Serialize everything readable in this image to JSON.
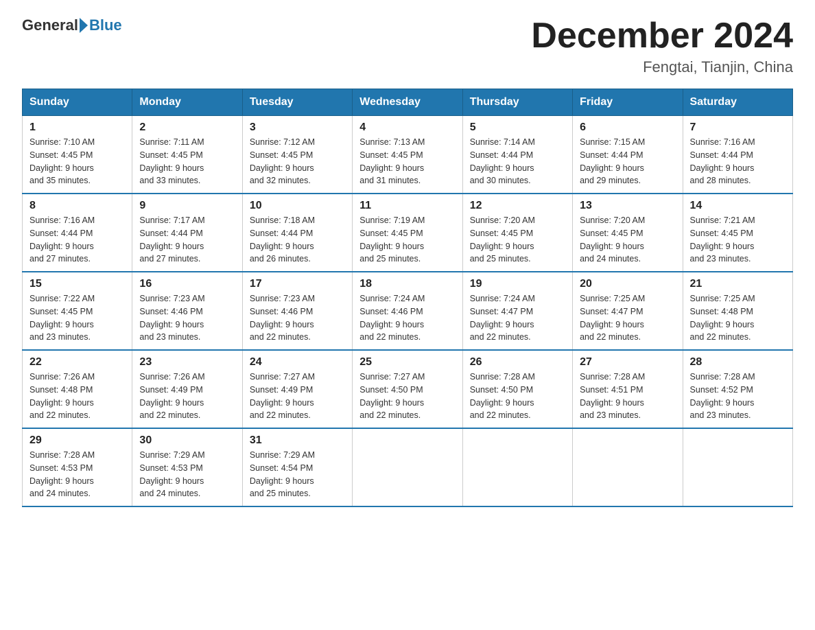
{
  "logo": {
    "general": "General",
    "blue": "Blue"
  },
  "title": {
    "month_year": "December 2024",
    "location": "Fengtai, Tianjin, China"
  },
  "headers": [
    "Sunday",
    "Monday",
    "Tuesday",
    "Wednesday",
    "Thursday",
    "Friday",
    "Saturday"
  ],
  "weeks": [
    [
      {
        "day": "1",
        "sunrise": "7:10 AM",
        "sunset": "4:45 PM",
        "daylight": "9 hours and 35 minutes."
      },
      {
        "day": "2",
        "sunrise": "7:11 AM",
        "sunset": "4:45 PM",
        "daylight": "9 hours and 33 minutes."
      },
      {
        "day": "3",
        "sunrise": "7:12 AM",
        "sunset": "4:45 PM",
        "daylight": "9 hours and 32 minutes."
      },
      {
        "day": "4",
        "sunrise": "7:13 AM",
        "sunset": "4:45 PM",
        "daylight": "9 hours and 31 minutes."
      },
      {
        "day": "5",
        "sunrise": "7:14 AM",
        "sunset": "4:44 PM",
        "daylight": "9 hours and 30 minutes."
      },
      {
        "day": "6",
        "sunrise": "7:15 AM",
        "sunset": "4:44 PM",
        "daylight": "9 hours and 29 minutes."
      },
      {
        "day": "7",
        "sunrise": "7:16 AM",
        "sunset": "4:44 PM",
        "daylight": "9 hours and 28 minutes."
      }
    ],
    [
      {
        "day": "8",
        "sunrise": "7:16 AM",
        "sunset": "4:44 PM",
        "daylight": "9 hours and 27 minutes."
      },
      {
        "day": "9",
        "sunrise": "7:17 AM",
        "sunset": "4:44 PM",
        "daylight": "9 hours and 27 minutes."
      },
      {
        "day": "10",
        "sunrise": "7:18 AM",
        "sunset": "4:44 PM",
        "daylight": "9 hours and 26 minutes."
      },
      {
        "day": "11",
        "sunrise": "7:19 AM",
        "sunset": "4:45 PM",
        "daylight": "9 hours and 25 minutes."
      },
      {
        "day": "12",
        "sunrise": "7:20 AM",
        "sunset": "4:45 PM",
        "daylight": "9 hours and 25 minutes."
      },
      {
        "day": "13",
        "sunrise": "7:20 AM",
        "sunset": "4:45 PM",
        "daylight": "9 hours and 24 minutes."
      },
      {
        "day": "14",
        "sunrise": "7:21 AM",
        "sunset": "4:45 PM",
        "daylight": "9 hours and 23 minutes."
      }
    ],
    [
      {
        "day": "15",
        "sunrise": "7:22 AM",
        "sunset": "4:45 PM",
        "daylight": "9 hours and 23 minutes."
      },
      {
        "day": "16",
        "sunrise": "7:23 AM",
        "sunset": "4:46 PM",
        "daylight": "9 hours and 23 minutes."
      },
      {
        "day": "17",
        "sunrise": "7:23 AM",
        "sunset": "4:46 PM",
        "daylight": "9 hours and 22 minutes."
      },
      {
        "day": "18",
        "sunrise": "7:24 AM",
        "sunset": "4:46 PM",
        "daylight": "9 hours and 22 minutes."
      },
      {
        "day": "19",
        "sunrise": "7:24 AM",
        "sunset": "4:47 PM",
        "daylight": "9 hours and 22 minutes."
      },
      {
        "day": "20",
        "sunrise": "7:25 AM",
        "sunset": "4:47 PM",
        "daylight": "9 hours and 22 minutes."
      },
      {
        "day": "21",
        "sunrise": "7:25 AM",
        "sunset": "4:48 PM",
        "daylight": "9 hours and 22 minutes."
      }
    ],
    [
      {
        "day": "22",
        "sunrise": "7:26 AM",
        "sunset": "4:48 PM",
        "daylight": "9 hours and 22 minutes."
      },
      {
        "day": "23",
        "sunrise": "7:26 AM",
        "sunset": "4:49 PM",
        "daylight": "9 hours and 22 minutes."
      },
      {
        "day": "24",
        "sunrise": "7:27 AM",
        "sunset": "4:49 PM",
        "daylight": "9 hours and 22 minutes."
      },
      {
        "day": "25",
        "sunrise": "7:27 AM",
        "sunset": "4:50 PM",
        "daylight": "9 hours and 22 minutes."
      },
      {
        "day": "26",
        "sunrise": "7:28 AM",
        "sunset": "4:50 PM",
        "daylight": "9 hours and 22 minutes."
      },
      {
        "day": "27",
        "sunrise": "7:28 AM",
        "sunset": "4:51 PM",
        "daylight": "9 hours and 23 minutes."
      },
      {
        "day": "28",
        "sunrise": "7:28 AM",
        "sunset": "4:52 PM",
        "daylight": "9 hours and 23 minutes."
      }
    ],
    [
      {
        "day": "29",
        "sunrise": "7:28 AM",
        "sunset": "4:53 PM",
        "daylight": "9 hours and 24 minutes."
      },
      {
        "day": "30",
        "sunrise": "7:29 AM",
        "sunset": "4:53 PM",
        "daylight": "9 hours and 24 minutes."
      },
      {
        "day": "31",
        "sunrise": "7:29 AM",
        "sunset": "4:54 PM",
        "daylight": "9 hours and 25 minutes."
      },
      null,
      null,
      null,
      null
    ]
  ],
  "labels": {
    "sunrise": "Sunrise:",
    "sunset": "Sunset:",
    "daylight": "Daylight:"
  }
}
